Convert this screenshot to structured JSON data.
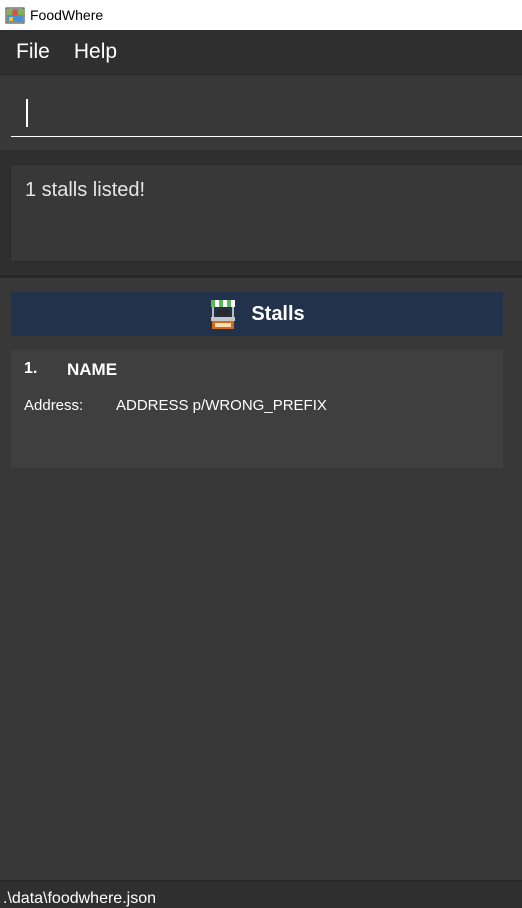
{
  "window": {
    "title": "FoodWhere",
    "app_icon": "map-icon"
  },
  "menubar": {
    "items": [
      {
        "label": "File"
      },
      {
        "label": "Help"
      }
    ]
  },
  "command_box": {
    "value": ""
  },
  "result_display": {
    "message": "1 stalls listed!"
  },
  "stall_list": {
    "header_label": "Stalls",
    "header_icon": "food-stall-icon",
    "cards": [
      {
        "index": "1.",
        "name": "NAME",
        "address_label": "Address:",
        "address": "ADDRESS p/WRONG_PREFIX"
      }
    ]
  },
  "status_bar": {
    "save_location": ".\\data\\foodwhere.json"
  },
  "colors": {
    "background": "#383838",
    "header_accent": "#22324a",
    "card_background": "#3f3f3f"
  }
}
